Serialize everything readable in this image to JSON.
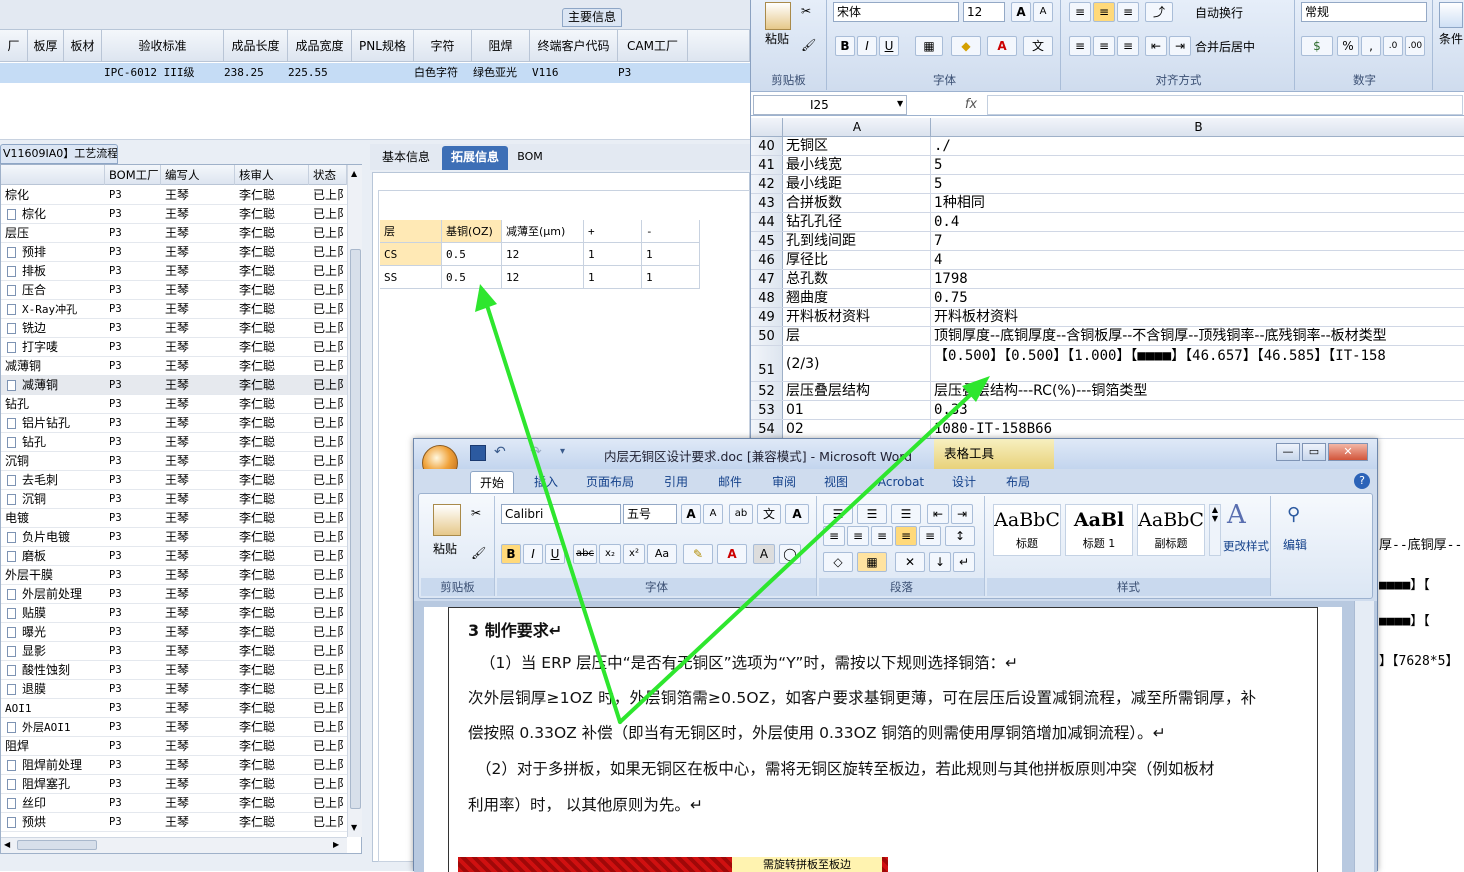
{
  "erp": {
    "main_info_tab": "主要信息",
    "top_columns": [
      "厂",
      "板厚",
      "板材",
      "验收标准",
      "成品长度",
      "成品宽度",
      "PNL规格",
      "字符",
      "阻焊",
      "终端客户代码",
      "CAM工厂"
    ],
    "top_row": {
      "standard": "IPC-6012 III级",
      "length": "238.25",
      "width": "225.55",
      "char": "白色字符",
      "solder": "绿色亚光",
      "customer": "V116",
      "cam": "P3"
    },
    "process_tab": "V11609IA0】工艺流程",
    "process_columns": [
      "",
      "BOM工厂",
      "编写人",
      "核审人",
      "状态"
    ],
    "process_rows": [
      {
        "name": "棕化",
        "group": true,
        "bom": "P3",
        "writer": "王琴",
        "reviewer": "李仁聪",
        "status": "已上阝"
      },
      {
        "name": "棕化",
        "group": false,
        "bom": "P3",
        "writer": "王琴",
        "reviewer": "李仁聪",
        "status": "已上阝"
      },
      {
        "name": "层压",
        "group": true,
        "bom": "P3",
        "writer": "王琴",
        "reviewer": "李仁聪",
        "status": "已上阝"
      },
      {
        "name": "预排",
        "group": false,
        "bom": "P3",
        "writer": "王琴",
        "reviewer": "李仁聪",
        "status": "已上阝"
      },
      {
        "name": "排板",
        "group": false,
        "bom": "P3",
        "writer": "王琴",
        "reviewer": "李仁聪",
        "status": "已上阝"
      },
      {
        "name": "压合",
        "group": false,
        "bom": "P3",
        "writer": "王琴",
        "reviewer": "李仁聪",
        "status": "已上阝"
      },
      {
        "name": "X-Ray冲孔",
        "group": false,
        "bom": "P3",
        "writer": "王琴",
        "reviewer": "李仁聪",
        "status": "已上阝"
      },
      {
        "name": "铣边",
        "group": false,
        "bom": "P3",
        "writer": "王琴",
        "reviewer": "李仁聪",
        "status": "已上阝"
      },
      {
        "name": "打字唛",
        "group": false,
        "bom": "P3",
        "writer": "王琴",
        "reviewer": "李仁聪",
        "status": "已上阝"
      },
      {
        "name": "减薄铜",
        "group": true,
        "bom": "P3",
        "writer": "王琴",
        "reviewer": "李仁聪",
        "status": "已上阝"
      },
      {
        "name": "减薄铜",
        "group": false,
        "bom": "P3",
        "writer": "王琴",
        "reviewer": "李仁聪",
        "status": "已上阝",
        "selected": true
      },
      {
        "name": "钻孔",
        "group": true,
        "bom": "P3",
        "writer": "王琴",
        "reviewer": "李仁聪",
        "status": "已上阝"
      },
      {
        "name": "铝片钻孔",
        "group": false,
        "bom": "P3",
        "writer": "王琴",
        "reviewer": "李仁聪",
        "status": "已上阝"
      },
      {
        "name": "钻孔",
        "group": false,
        "bom": "P3",
        "writer": "王琴",
        "reviewer": "李仁聪",
        "status": "已上阝"
      },
      {
        "name": "沉铜",
        "group": true,
        "bom": "P3",
        "writer": "王琴",
        "reviewer": "李仁聪",
        "status": "已上阝"
      },
      {
        "name": "去毛刺",
        "group": false,
        "bom": "P3",
        "writer": "王琴",
        "reviewer": "李仁聪",
        "status": "已上阝"
      },
      {
        "name": "沉铜",
        "group": false,
        "bom": "P3",
        "writer": "王琴",
        "reviewer": "李仁聪",
        "status": "已上阝"
      },
      {
        "name": "电镀",
        "group": true,
        "bom": "P3",
        "writer": "王琴",
        "reviewer": "李仁聪",
        "status": "已上阝"
      },
      {
        "name": "负片电镀",
        "group": false,
        "bom": "P3",
        "writer": "王琴",
        "reviewer": "李仁聪",
        "status": "已上阝"
      },
      {
        "name": "磨板",
        "group": false,
        "bom": "P3",
        "writer": "王琴",
        "reviewer": "李仁聪",
        "status": "已上阝"
      },
      {
        "name": "外层干膜",
        "group": true,
        "bom": "P3",
        "writer": "王琴",
        "reviewer": "李仁聪",
        "status": "已上阝"
      },
      {
        "name": "外层前处理",
        "group": false,
        "bom": "P3",
        "writer": "王琴",
        "reviewer": "李仁聪",
        "status": "已上阝"
      },
      {
        "name": "贴膜",
        "group": false,
        "bom": "P3",
        "writer": "王琴",
        "reviewer": "李仁聪",
        "status": "已上阝"
      },
      {
        "name": "曝光",
        "group": false,
        "bom": "P3",
        "writer": "王琴",
        "reviewer": "李仁聪",
        "status": "已上阝"
      },
      {
        "name": "显影",
        "group": false,
        "bom": "P3",
        "writer": "王琴",
        "reviewer": "李仁聪",
        "status": "已上阝"
      },
      {
        "name": "酸性蚀刻",
        "group": false,
        "bom": "P3",
        "writer": "王琴",
        "reviewer": "李仁聪",
        "status": "已上阝"
      },
      {
        "name": "退膜",
        "group": false,
        "bom": "P3",
        "writer": "王琴",
        "reviewer": "李仁聪",
        "status": "已上阝"
      },
      {
        "name": "AOI1",
        "group": true,
        "bom": "P3",
        "writer": "王琴",
        "reviewer": "李仁聪",
        "status": "已上阝"
      },
      {
        "name": "外层AOI1",
        "group": false,
        "bom": "P3",
        "writer": "王琴",
        "reviewer": "李仁聪",
        "status": "已上阝"
      },
      {
        "name": "阻焊",
        "group": true,
        "bom": "P3",
        "writer": "王琴",
        "reviewer": "李仁聪",
        "status": "已上阝"
      },
      {
        "name": "阻焊前处理",
        "group": false,
        "bom": "P3",
        "writer": "王琴",
        "reviewer": "李仁聪",
        "status": "已上阝"
      },
      {
        "name": "阻焊塞孔",
        "group": false,
        "bom": "P3",
        "writer": "王琴",
        "reviewer": "李仁聪",
        "status": "已上阝"
      },
      {
        "name": "丝印",
        "group": false,
        "bom": "P3",
        "writer": "王琴",
        "reviewer": "李仁聪",
        "status": "已上阝"
      },
      {
        "name": "预烘",
        "group": false,
        "bom": "P3",
        "writer": "王琴",
        "reviewer": "李仁聪",
        "status": "已上阝"
      }
    ],
    "right_tabs": [
      "基本信息",
      "拓展信息",
      "BOM"
    ],
    "ext_columns": [
      "层",
      "基铜(OZ)",
      "减薄至(μm)",
      "+",
      "-"
    ],
    "ext_rows": [
      [
        "CS",
        "0.5",
        "12",
        "1",
        "1"
      ],
      [
        "SS",
        "0.5",
        "12",
        "1",
        "1"
      ]
    ]
  },
  "excel": {
    "clipboard": "剪贴板",
    "paste": "粘贴",
    "font_name": "宋体",
    "font_size": "12",
    "font_group": "字体",
    "align_group": "对齐方式",
    "wrap": "自动换行",
    "merge": "合并后居中",
    "number_format": "常规",
    "number_group": "数字",
    "cond": "条件",
    "namebox": "I25",
    "fx": "fx",
    "col_a": "A",
    "col_b": "B",
    "rows": [
      {
        "n": "40",
        "a": "无铜区",
        "b": "./"
      },
      {
        "n": "41",
        "a": "最小线宽",
        "b": "5"
      },
      {
        "n": "42",
        "a": "最小线距",
        "b": "5"
      },
      {
        "n": "43",
        "a": "合拼板数",
        "b": "1种相同"
      },
      {
        "n": "44",
        "a": "钻孔孔径",
        "b": "0.4"
      },
      {
        "n": "45",
        "a": "孔到线间距",
        "b": "7"
      },
      {
        "n": "46",
        "a": "厚径比",
        "b": "4"
      },
      {
        "n": "47",
        "a": "总孔数",
        "b": "1798"
      },
      {
        "n": "48",
        "a": "翘曲度",
        "b": "0.75"
      },
      {
        "n": "49",
        "a": "开料板材资料",
        "b": "开料板材资料"
      },
      {
        "n": "50",
        "a": "层",
        "b": "顶铜厚度--底铜厚度--含铜板厚--不含铜厚--顶残铜率--底残铜率--板材类型"
      },
      {
        "n": "51",
        "a": "(2/3)",
        "b": "【0.500】【0.500】【1.000】【■■■■】【46.657】【46.585】【IT-158"
      },
      {
        "n": "52",
        "a": "层压叠层结构",
        "b": "层压叠层结构---RC(%)---铜箔类型"
      },
      {
        "n": "53",
        "a": "01",
        "b": "0.33"
      },
      {
        "n": "54",
        "a": "02",
        "b": "1080-IT-158B66"
      }
    ],
    "peek": [
      "厚--底铜厚--",
      "■■■■】【",
      "■■■■】【",
      "】【7628*5】"
    ]
  },
  "word": {
    "title": "内层无铜区设计要求.doc [兼容模式] - Microsoft Word",
    "table_tools": "表格工具",
    "tabs": [
      "开始",
      "插入",
      "页面布局",
      "引用",
      "邮件",
      "审阅",
      "视图",
      "Acrobat",
      "设计",
      "布局"
    ],
    "paste": "粘贴",
    "clipboard": "剪贴板",
    "font_name": "Calibri",
    "font_size": "五号",
    "font_group": "字体",
    "para_group": "段落",
    "styles": [
      {
        "sample": "AaBbC",
        "name": "标题"
      },
      {
        "sample": "AaBl",
        "name": "标题 1"
      },
      {
        "sample": "AaBbC",
        "name": "副标题"
      }
    ],
    "styles_group": "样式",
    "change_styles": "更改样式",
    "edit": "编辑",
    "body": [
      "3 制作要求↵",
      "（1）当 ERP 层压中“是否有无铜区”选项为“Y”时，需按以下规则选择铜箔：↵",
      "次外层铜厚≥1OZ 时，外层铜箔需≥0.5OZ，如客户要求基铜更薄，可在层压后设置减铜流程，减至所需铜厚，补",
      "偿按照 0.33OZ 补偿（即当有无铜区时，外层使用 0.33OZ 铜箔的则需使用厚铜箔增加减铜流程）。↵",
      "（2）对于多拼板，如果无铜区在板中心，需将无铜区旋转至板边，若此规则与其他拼板原则冲突（例如板材",
      "利用率）时，  以其他原则为先。↵"
    ],
    "image_caption": "需旋转拼板至板边"
  },
  "colors": {
    "arrow": "#2ee62e",
    "erp_select": "#c5dcf5",
    "tab_active": "#3d6fb6",
    "ext_header": "#ffe9b5"
  }
}
